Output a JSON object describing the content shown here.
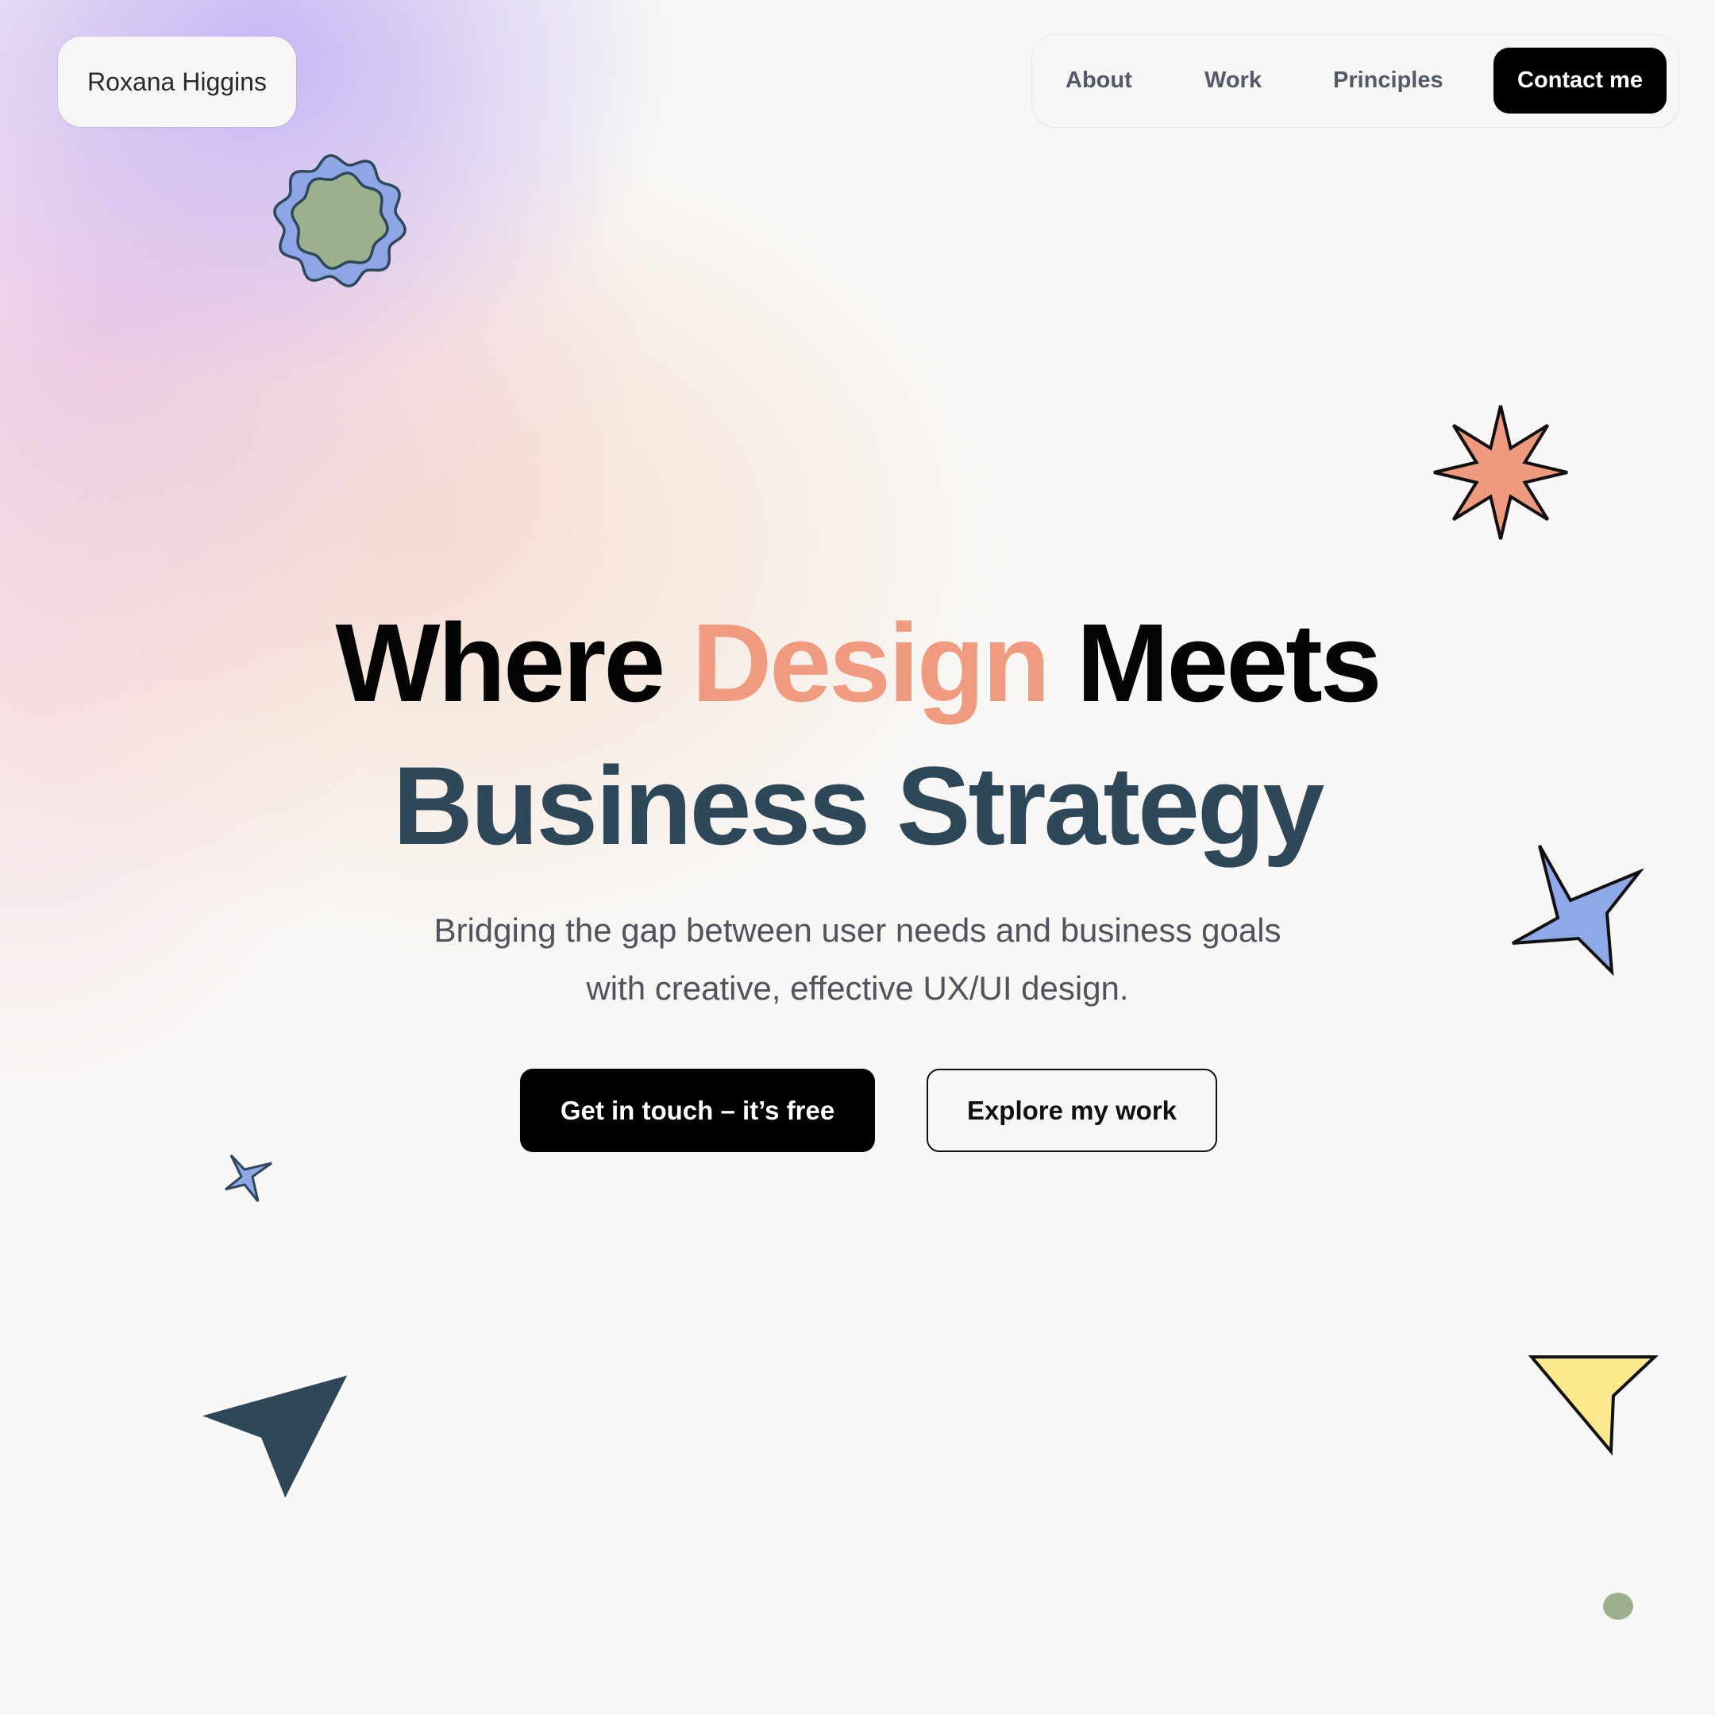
{
  "header": {
    "logo_text": "Roxana Higgins"
  },
  "nav": {
    "about": "About",
    "work": "Work",
    "principles": "Principles",
    "contact": "Contact me"
  },
  "hero": {
    "title_part1": "Where ",
    "title_accent": "Design",
    "title_part2": " Meets",
    "title_line2": "Business Strategy",
    "subtitle_line1": "Bridging the gap between user needs and business goals",
    "subtitle_line2": "with creative, effective UX/UI design."
  },
  "actions": {
    "primary": "Get in touch – it’s free",
    "secondary": "Explore my work"
  },
  "colors": {
    "accent": "#f09b7f",
    "heading_dark": "#2e4759",
    "text_muted": "#50535d",
    "background": "#f8f7f5"
  },
  "decorations": [
    "wavy-flower-icon",
    "eight-point-star-icon",
    "four-point-star-icon",
    "small-star-icon",
    "paper-plane-arrow-icon",
    "cursor-triangle-icon",
    "dot-icon"
  ]
}
